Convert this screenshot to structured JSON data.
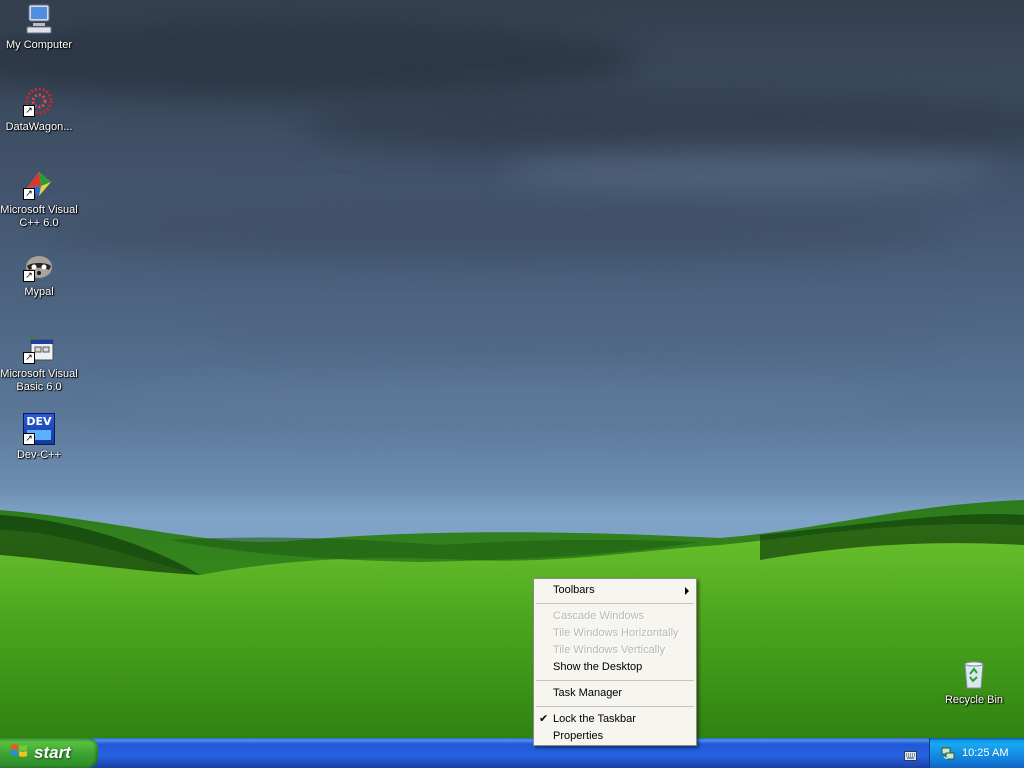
{
  "desktop": {
    "icons": [
      {
        "label": "My Computer",
        "icon": "my-computer-icon"
      },
      {
        "label": "DataWagon...",
        "icon": "datawagon-icon"
      },
      {
        "label_line1": "Microsoft Visual",
        "label_line2": "C++ 6.0",
        "icon": "visual-cpp-icon"
      },
      {
        "label": "Mypal",
        "icon": "mypal-icon"
      },
      {
        "label_line1": "Microsoft Visual",
        "label_line2": "Basic 6.0",
        "icon": "visual-basic-icon"
      },
      {
        "label": "Dev-C++",
        "icon": "dev-cpp-icon",
        "badge": "DEV"
      },
      {
        "label": "Recycle Bin",
        "icon": "recycle-bin-icon"
      }
    ]
  },
  "context_menu": {
    "items": [
      {
        "label": "Toolbars",
        "submenu": true
      },
      {
        "label": "Cascade Windows",
        "disabled": true
      },
      {
        "label": "Tile Windows Horizontally",
        "disabled": true
      },
      {
        "label": "Tile Windows Vertically",
        "disabled": true
      },
      {
        "label": "Show the Desktop"
      },
      {
        "label": "Task Manager"
      },
      {
        "label": "Lock the Taskbar",
        "checked": true,
        "check_glyph": "✔"
      },
      {
        "label": "Properties"
      }
    ]
  },
  "taskbar": {
    "start_label": "start",
    "clock": "10:25 AM"
  },
  "colors": {
    "taskbar_blue": "#2663e0",
    "start_green": "#3aa233",
    "tray_blue": "#1382dd",
    "menu_bg": "#f6f5f0"
  }
}
